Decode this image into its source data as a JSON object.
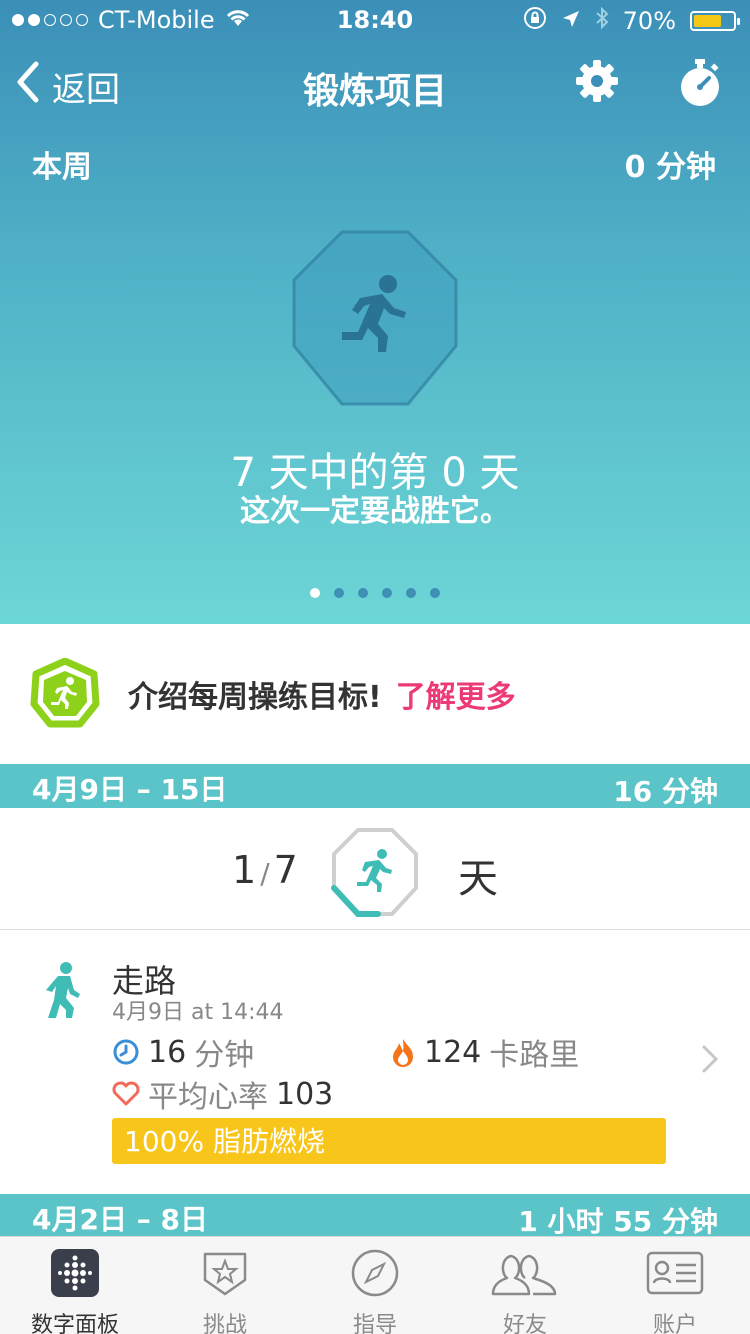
{
  "status": {
    "carrier": "CT-Mobile",
    "time": "18:40",
    "battery": "70%",
    "battery_level": 0.7
  },
  "nav": {
    "back_label": "返回",
    "title": "锻炼项目"
  },
  "week": {
    "label": "本周",
    "minutes": "0 分钟"
  },
  "hero": {
    "days_text": "7 天中的第 0 天",
    "subtitle": "这次一定要战胜它。",
    "pager_count": 6,
    "pager_active": 0
  },
  "promo": {
    "text": "介绍每周操练目标!",
    "link": "了解更多"
  },
  "sections": [
    {
      "range": "4月9日 – 15日",
      "total": "16 分钟"
    },
    {
      "range": "4月2日 – 8日",
      "total": "1 小时 55 分钟"
    }
  ],
  "summary": {
    "done": "1",
    "goal": "7",
    "unit": "天",
    "progress": 0.143
  },
  "activity": {
    "name": "走路",
    "date": "4月9日 at 14:44",
    "duration_value": "16",
    "duration_unit": "分钟",
    "calories_value": "124",
    "calories_unit": "卡路里",
    "hr_label": "平均心率",
    "hr_value": "103",
    "fatburn": "100% 脂肪燃烧"
  },
  "tabs": [
    {
      "label": "数字面板",
      "icon": "dashboard-icon"
    },
    {
      "label": "挑战",
      "icon": "challenge-star-icon"
    },
    {
      "label": "指导",
      "icon": "compass-icon"
    },
    {
      "label": "好友",
      "icon": "friends-icon"
    },
    {
      "label": "账户",
      "icon": "account-card-icon"
    }
  ],
  "colors": {
    "accent": "#5bc4c8",
    "link": "#ec3a78",
    "fatburn": "#f8c51a",
    "badge_green": "#8ed11a"
  }
}
